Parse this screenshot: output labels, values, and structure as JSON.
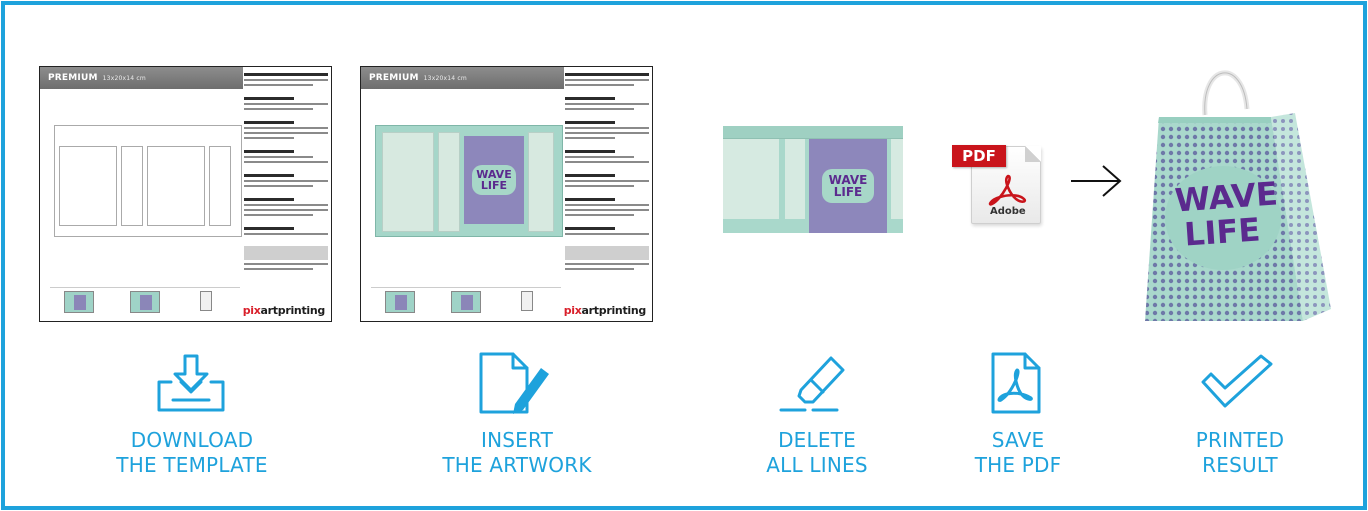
{
  "sheet": {
    "header_title": "PREMIUM",
    "header_sub": "13x20x14 cm",
    "brand_red": "pix",
    "brand_rest": "artprinting"
  },
  "artwork": {
    "line1": "WAVE",
    "line2": "LIFE"
  },
  "pdf_icon": {
    "tag": "PDF",
    "brand": "Adobe"
  },
  "steps": [
    {
      "line1": "DOWNLOAD",
      "line2": "THE TEMPLATE",
      "icon": "download-tray-icon"
    },
    {
      "line1": "INSERT",
      "line2": "THE ARTWORK",
      "icon": "document-pen-icon"
    },
    {
      "line1": "DELETE",
      "line2": "ALL LINES",
      "icon": "eraser-icon"
    },
    {
      "line1": "SAVE",
      "line2": "THE PDF",
      "icon": "pdf-file-icon"
    },
    {
      "line1": "PRINTED",
      "line2": "RESULT",
      "icon": "checkmark-icon"
    }
  ],
  "colors": {
    "accent": "#1ea2dc",
    "artwork_teal": "#a5d6c9",
    "artwork_purple": "#8d87bb",
    "pdf_red": "#c9141b"
  }
}
